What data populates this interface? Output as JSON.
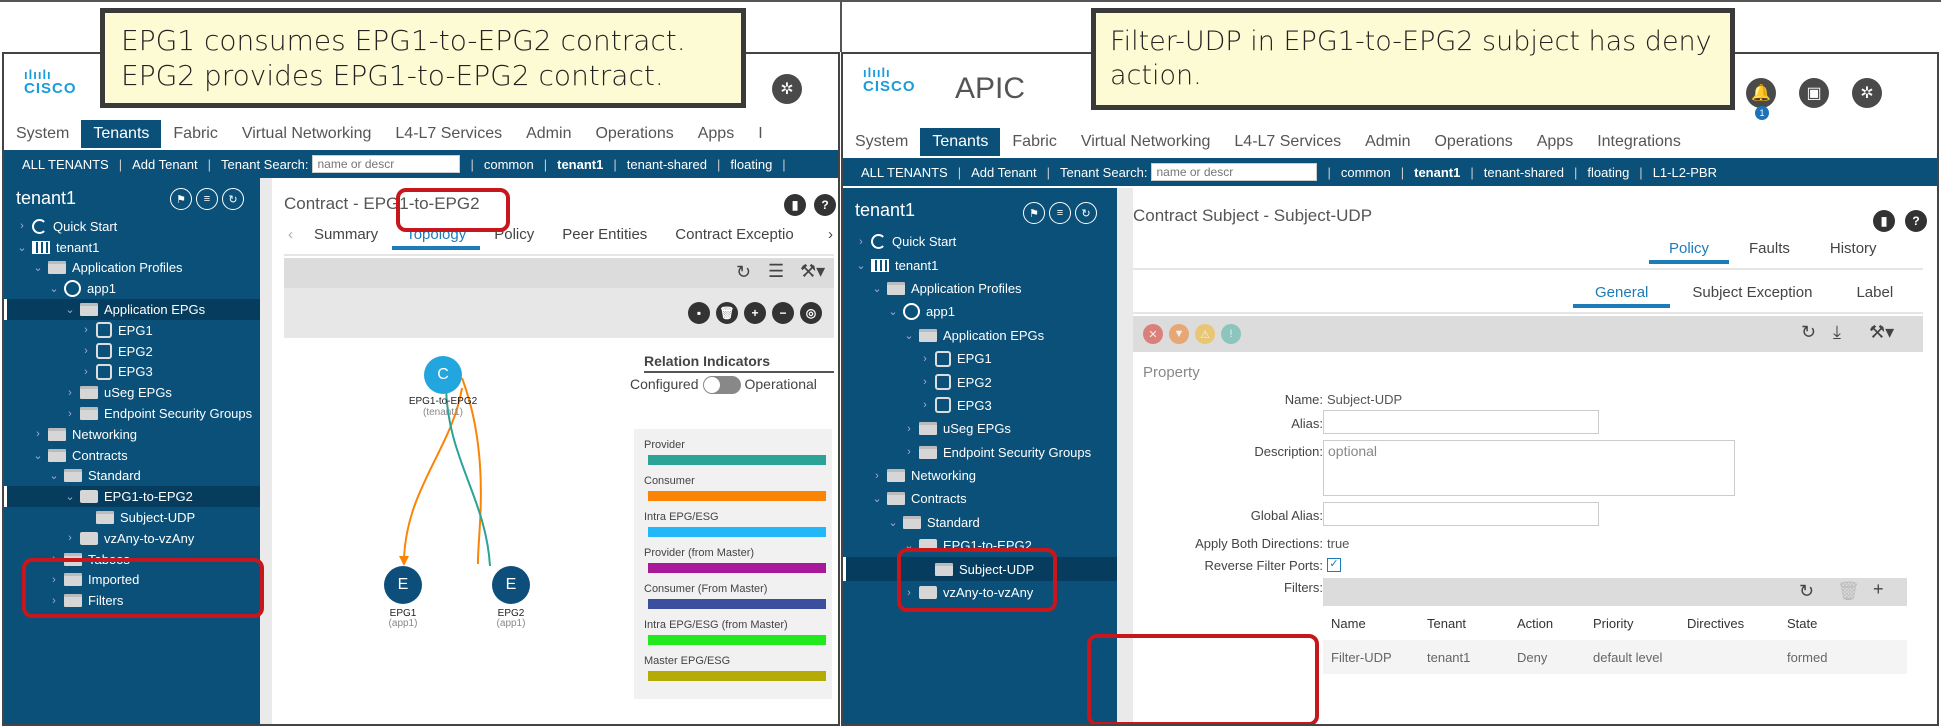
{
  "callouts": {
    "left": [
      "EPG1 consumes EPG1-to-EPG2 contract.",
      "EPG2 provides EPG1-to-EPG2 contract."
    ],
    "right": "Filter-UDP in EPG1-to-EPG2 subject has deny action."
  },
  "left": {
    "logo": {
      "bars": "ılıılı",
      "word": "CISCO"
    },
    "top_nav": [
      "System",
      "Tenants",
      "Fabric",
      "Virtual Networking",
      "L4-L7 Services",
      "Admin",
      "Operations",
      "Apps",
      "I"
    ],
    "active_top_nav": "Tenants",
    "sub_nav": {
      "all_tenants": "ALL TENANTS",
      "add_tenant": "Add Tenant",
      "search_label": "Tenant Search:",
      "search_placeholder": "name or descr",
      "tenants": [
        "common",
        "tenant1",
        "tenant-shared",
        "floating"
      ]
    },
    "sidebar": {
      "title": "tenant1",
      "tree": [
        {
          "label": "Quick Start",
          "icon": "quick-start-icon",
          "chev": ">",
          "depth": 0
        },
        {
          "label": "tenant1",
          "icon": "building-icon",
          "chev": "v",
          "depth": 0
        },
        {
          "label": "Application Profiles",
          "icon": "folder-icon",
          "chev": "v",
          "depth": 1
        },
        {
          "label": "app1",
          "icon": "app-profile-icon",
          "chev": "v",
          "depth": 2
        },
        {
          "label": "Application EPGs",
          "icon": "folder-icon",
          "chev": "v",
          "depth": 3,
          "selected": true
        },
        {
          "label": "EPG1",
          "icon": "epg-icon",
          "chev": ">",
          "depth": 4
        },
        {
          "label": "EPG2",
          "icon": "epg-icon",
          "chev": ">",
          "depth": 4
        },
        {
          "label": "EPG3",
          "icon": "epg-icon",
          "chev": ">",
          "depth": 4
        },
        {
          "label": "uSeg EPGs",
          "icon": "folder-icon",
          "chev": ">",
          "depth": 3
        },
        {
          "label": "Endpoint Security Groups",
          "icon": "folder-icon",
          "chev": ">",
          "depth": 3
        },
        {
          "label": "Networking",
          "icon": "folder-icon",
          "chev": ">",
          "depth": 1
        },
        {
          "label": "Contracts",
          "icon": "folder-icon",
          "chev": "v",
          "depth": 1
        },
        {
          "label": "Standard",
          "icon": "folder-icon",
          "chev": "v",
          "depth": 2
        },
        {
          "label": "EPG1-to-EPG2",
          "icon": "contract-icon",
          "chev": "v",
          "depth": 3,
          "selected": true
        },
        {
          "label": "Subject-UDP",
          "icon": "folder-icon",
          "chev": "",
          "depth": 4
        },
        {
          "label": "vzAny-to-vzAny",
          "icon": "contract-icon",
          "chev": ">",
          "depth": 3
        },
        {
          "label": "Taboos",
          "icon": "folder-icon",
          "chev": ">",
          "depth": 2
        },
        {
          "label": "Imported",
          "icon": "folder-icon",
          "chev": ">",
          "depth": 2
        },
        {
          "label": "Filters",
          "icon": "folder-icon",
          "chev": ">",
          "depth": 2
        }
      ]
    },
    "content": {
      "title": "Contract - EPG1-to-EPG2",
      "tabs": [
        "Summary",
        "Topology",
        "Policy",
        "Peer Entities",
        "Contract Exceptio"
      ],
      "active_tab": "Topology",
      "relation_title": "Relation Indicators",
      "toggle_left": "Configured",
      "toggle_right": "Operational",
      "nodes": {
        "contract": {
          "glyph": "C",
          "label": "EPG1-to-EPG2",
          "sub": "(tenant1)"
        },
        "epg1": {
          "glyph": "E",
          "label": "EPG1",
          "sub": "(app1)"
        },
        "epg2": {
          "glyph": "E",
          "label": "EPG2",
          "sub": "(app1)"
        }
      },
      "legend": [
        {
          "label": "Provider",
          "color": "#2ba396"
        },
        {
          "label": "Consumer",
          "color": "#fb8406"
        },
        {
          "label": "Intra EPG/ESG",
          "color": "#22b7f8"
        },
        {
          "label": "Provider (from Master)",
          "color": "#a8199a"
        },
        {
          "label": "Consumer (From Master)",
          "color": "#3c4f9e"
        },
        {
          "label": "Intra EPG/ESG (from Master)",
          "color": "#22e81e"
        },
        {
          "label": "Master EPG/ESG",
          "color": "#b4ab06"
        }
      ]
    }
  },
  "right": {
    "logo": {
      "bars": "ılıılı",
      "word": "CISCO"
    },
    "app_name": "APIC",
    "notification_count": "1",
    "top_nav": [
      "System",
      "Tenants",
      "Fabric",
      "Virtual Networking",
      "L4-L7 Services",
      "Admin",
      "Operations",
      "Apps",
      "Integrations"
    ],
    "active_top_nav": "Tenants",
    "sub_nav": {
      "all_tenants": "ALL TENANTS",
      "add_tenant": "Add Tenant",
      "search_label": "Tenant Search:",
      "search_placeholder": "name or descr",
      "tenants": [
        "common",
        "tenant1",
        "tenant-shared",
        "floating",
        "L1-L2-PBR"
      ]
    },
    "sidebar": {
      "title": "tenant1",
      "tree": [
        {
          "label": "Quick Start",
          "icon": "quick-start-icon",
          "chev": ">",
          "depth": 0
        },
        {
          "label": "tenant1",
          "icon": "building-icon",
          "chev": "v",
          "depth": 0
        },
        {
          "label": "Application Profiles",
          "icon": "folder-icon",
          "chev": "v",
          "depth": 1
        },
        {
          "label": "app1",
          "icon": "app-profile-icon",
          "chev": "v",
          "depth": 2
        },
        {
          "label": "Application EPGs",
          "icon": "folder-icon",
          "chev": "v",
          "depth": 3
        },
        {
          "label": "EPG1",
          "icon": "epg-icon",
          "chev": ">",
          "depth": 4
        },
        {
          "label": "EPG2",
          "icon": "epg-icon",
          "chev": ">",
          "depth": 4
        },
        {
          "label": "EPG3",
          "icon": "epg-icon",
          "chev": ">",
          "depth": 4
        },
        {
          "label": "uSeg EPGs",
          "icon": "folder-icon",
          "chev": ">",
          "depth": 3
        },
        {
          "label": "Endpoint Security Groups",
          "icon": "folder-icon",
          "chev": ">",
          "depth": 3
        },
        {
          "label": "Networking",
          "icon": "folder-icon",
          "chev": ">",
          "depth": 1
        },
        {
          "label": "Contracts",
          "icon": "folder-icon",
          "chev": "v",
          "depth": 1
        },
        {
          "label": "Standard",
          "icon": "folder-icon",
          "chev": "v",
          "depth": 2
        },
        {
          "label": "EPG1-to-EPG2",
          "icon": "contract-icon",
          "chev": "v",
          "depth": 3
        },
        {
          "label": "Subject-UDP",
          "icon": "folder-icon",
          "chev": "",
          "depth": 4,
          "selected": true
        },
        {
          "label": "vzAny-to-vzAny",
          "icon": "contract-icon",
          "chev": ">",
          "depth": 3
        }
      ]
    },
    "content": {
      "title": "Contract Subject - Subject-UDP",
      "tabs": [
        "Policy",
        "Faults",
        "History"
      ],
      "active_tab": "Policy",
      "subtabs": [
        "General",
        "Subject Exception",
        "Label"
      ],
      "active_subtab": "General",
      "section": "Property",
      "fields": {
        "name_label": "Name:",
        "name_value": "Subject-UDP",
        "alias_label": "Alias:",
        "alias_value": "",
        "description_label": "Description:",
        "description_placeholder": "optional",
        "global_alias_label": "Global Alias:",
        "global_alias_value": "",
        "apply_both_label": "Apply Both Directions:",
        "apply_both_value": "true",
        "reverse_label": "Reverse Filter Ports:",
        "reverse_checked": true,
        "filters_label": "Filters:"
      },
      "filters_table": {
        "columns": [
          "Name",
          "Tenant",
          "Action",
          "Priority",
          "Directives",
          "State"
        ],
        "rows": [
          [
            "Filter-UDP",
            "tenant1",
            "Deny",
            "default level",
            "",
            "formed"
          ]
        ]
      }
    }
  }
}
